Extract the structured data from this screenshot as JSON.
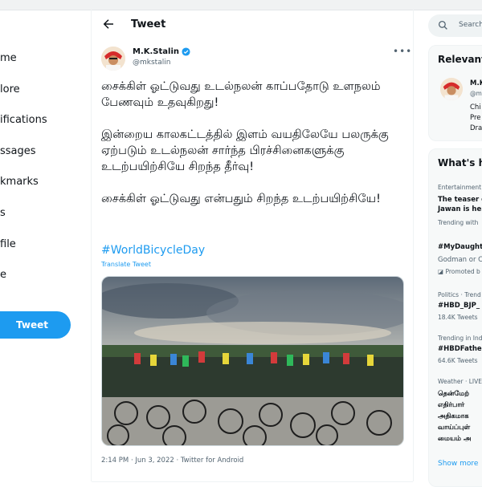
{
  "nav": {
    "items": [
      "me",
      "lore",
      "ifications",
      "ssages",
      "kmarks",
      "s",
      "file",
      "e"
    ],
    "tweet_button": "Tweet"
  },
  "header": {
    "title": "Tweet",
    "back_icon": "arrow-left-icon"
  },
  "tweet": {
    "author_name": "M.K.Stalin",
    "author_handle": "@mkstalin",
    "verified_icon": "verified-badge-icon",
    "text": "சைக்கிள் ஓட்டுவது உடல்நலன் காப்பதோடு உளநலம் பேணவும் உதவுகிறது!\n\nஇன்றைய காலகட்டத்தில் இளம் வயதிலேயே பலருக்கு ஏற்படும் உடல்நலன் சார்ந்த பிரச்சினைகளுக்கு உடற்பயிற்சியே சிறந்த தீர்வு!\n\nசைக்கிள் ஓட்டுவது என்பதும் சிறந்த உடற்பயிற்சியே!",
    "hashtag": "#WorldBicycleDay",
    "translate": "Translate Tweet",
    "timestamp": "2:14 PM · Jun 3, 2022 · Twitter for Android"
  },
  "search": {
    "placeholder": "Search"
  },
  "relevant": {
    "title": "Relevant",
    "handle": "@m",
    "name": "M.K",
    "bio_lines": [
      "Chi",
      "Pre",
      "Dra"
    ]
  },
  "whats": {
    "title": "What's h",
    "trends": [
      {
        "context": "Entertainment",
        "title": "The teaser o",
        "subtitle": "Jawan is her",
        "meta": "Trending with"
      },
      {
        "context": "",
        "title": "#MyDaught",
        "subtitle": "Godman or C",
        "meta": "Promoted b"
      },
      {
        "context": "Politics · Trend",
        "title": "#HBD_BJP_",
        "subtitle": "",
        "meta": "18.4K Tweets"
      },
      {
        "context": "Trending in Ind",
        "title": "#HBDFathe",
        "subtitle": "",
        "meta": "64.6K Tweets"
      },
      {
        "context": "Weather · LIVE",
        "title": "தென்மேற்",
        "lines": [
          "எதிர்பார்",
          "அதிகமாக",
          "வாய்ப்புள்",
          "மையம் அ"
        ]
      }
    ],
    "show_more": "Show more"
  },
  "colors": {
    "accent": "#1d9bf0",
    "text": "#0f1419",
    "muted": "#536471"
  }
}
